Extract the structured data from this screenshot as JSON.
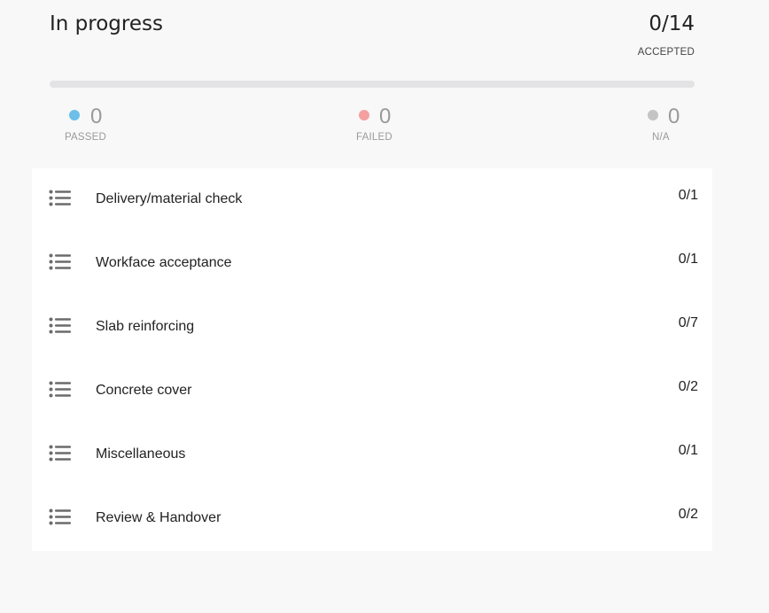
{
  "summary": {
    "status_title": "In progress",
    "accepted_count": "0/14",
    "accepted_label": "ACCEPTED",
    "progress_fraction": 0,
    "stats": [
      {
        "value": "0",
        "label": "PASSED",
        "color": "#6cc0e8"
      },
      {
        "value": "0",
        "label": "FAILED",
        "color": "#f5a0a0"
      },
      {
        "value": "0",
        "label": "N/A",
        "color": "#c4c4c4"
      }
    ]
  },
  "checklist": {
    "icon": "list-icon",
    "items": [
      {
        "name": "Delivery/material check",
        "count": "0/1"
      },
      {
        "name": "Workface acceptance",
        "count": "0/1"
      },
      {
        "name": "Slab reinforcing",
        "count": "0/7"
      },
      {
        "name": "Concrete cover",
        "count": "0/2"
      },
      {
        "name": "Miscellaneous",
        "count": "0/1"
      },
      {
        "name": "Review & Handover",
        "count": "0/2"
      }
    ]
  }
}
